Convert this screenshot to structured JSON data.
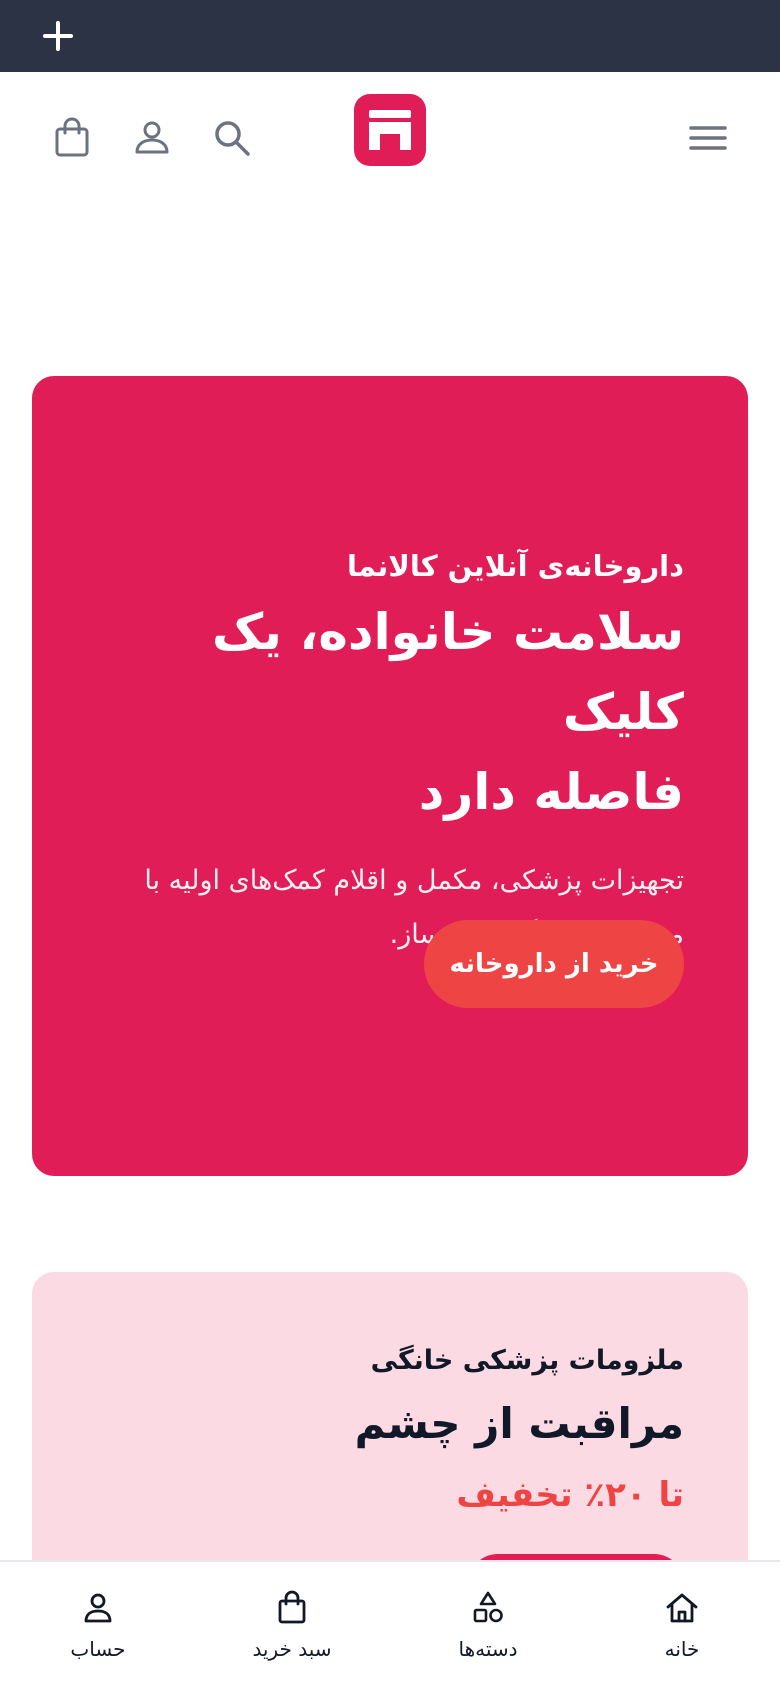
{
  "topbar": {
    "new_tab_icon": "plus-icon"
  },
  "header": {
    "menu_icon": "hamburger-menu-icon",
    "logo_icon": "store-logo-icon",
    "search_icon": "search-icon",
    "account_icon": "user-icon",
    "cart_icon": "shopping-bag-icon"
  },
  "hero": {
    "subtitle": "داروخانه‌ی آنلاین کالانما",
    "title_line1": "سلامت خانواده، یک کلیک",
    "title_line2": "فاصله دارد",
    "description_line1": "تجهیزات پزشکی، مکمل و اقلام کمک‌های اولیه با",
    "description_line2": "مشاوره‌ی رایگان داروساز.",
    "cta_label": "خرید از داروخانه"
  },
  "promo": {
    "subtitle": "ملزومات پزشکی خانگی",
    "title": "مراقبت از چشم",
    "discount": "تا ۲۰٪ تخفیف"
  },
  "bottom_nav": {
    "items": [
      {
        "label": "خانه",
        "icon": "home-icon"
      },
      {
        "label": "دسته‌ها",
        "icon": "categories-shapes-icon"
      },
      {
        "label": "سبد خرید",
        "icon": "shopping-bag-icon"
      },
      {
        "label": "حساب",
        "icon": "user-icon"
      }
    ]
  },
  "colors": {
    "brand": "#e11d58",
    "accent": "#ef4444",
    "topbar": "#2b3344",
    "promo_bg": "#fbdae3",
    "icon_gray": "#6b7280"
  }
}
